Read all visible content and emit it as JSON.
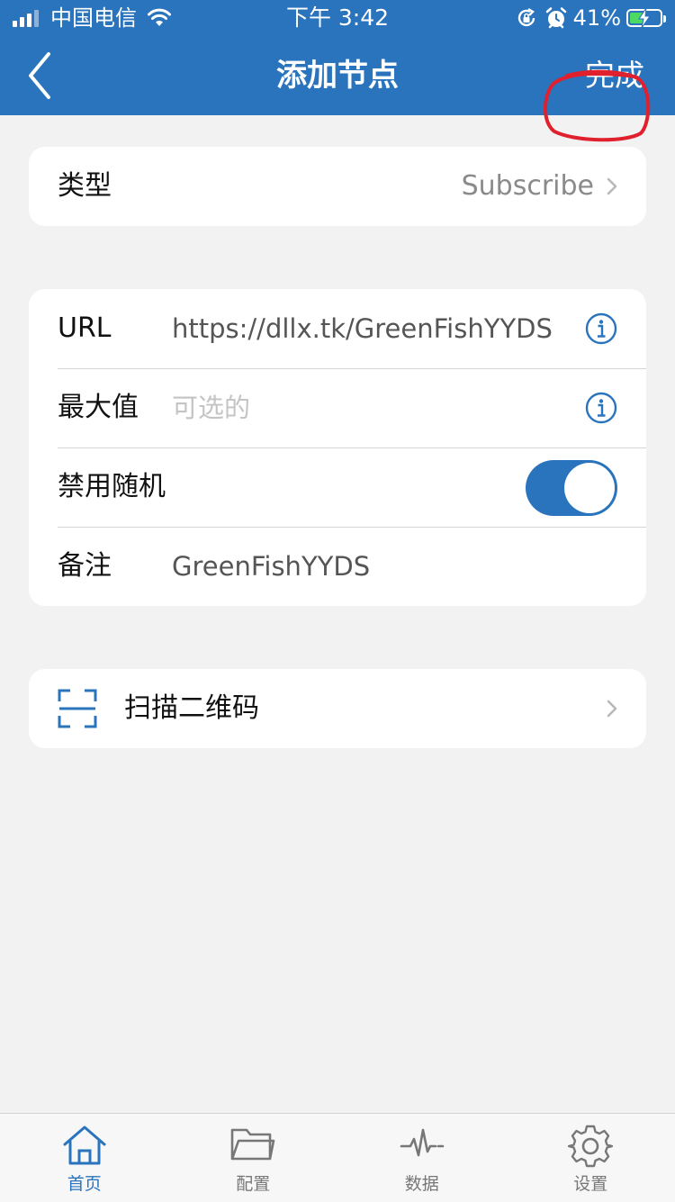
{
  "status_bar": {
    "carrier": "中国电信",
    "time": "下午 3:42",
    "battery_percent": "41%",
    "battery_level": 0.41,
    "icons": [
      "signal-icon",
      "wifi-icon",
      "rotation-lock-icon",
      "alarm-icon",
      "battery-icon"
    ]
  },
  "nav": {
    "title": "添加节点",
    "done_label": "完成",
    "back_icon": "chevron-left-icon",
    "annotation_color": "#e0202c"
  },
  "type_card": {
    "label": "类型",
    "value": "Subscribe"
  },
  "form": {
    "url_label": "URL",
    "url_value": "https://dllx.tk/GreenFishYYDS",
    "max_label": "最大值",
    "max_placeholder": "可选的",
    "disable_random_label": "禁用随机",
    "disable_random_on": true,
    "remark_label": "备注",
    "remark_value": "GreenFishYYDS"
  },
  "scan": {
    "label": "扫描二维码",
    "icon": "qr-scan-icon"
  },
  "tabs": [
    {
      "label": "首页",
      "icon": "home-icon",
      "active": true
    },
    {
      "label": "配置",
      "icon": "folder-icon",
      "active": false
    },
    {
      "label": "数据",
      "icon": "pulse-icon",
      "active": false
    },
    {
      "label": "设置",
      "icon": "gear-icon",
      "active": false
    }
  ],
  "colors": {
    "primary": "#2a74bd",
    "background": "#f2f2f2",
    "toggle_on": "#2a74bd"
  }
}
